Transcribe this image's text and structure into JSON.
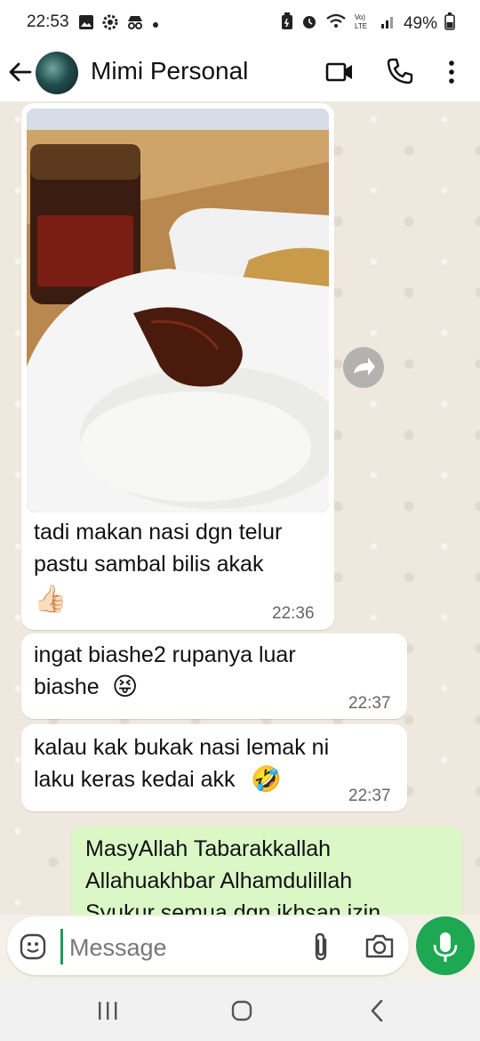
{
  "status_bar": {
    "time": "22:53",
    "battery": "49%",
    "left_icons": [
      "gallery-icon",
      "settings-gear-icon",
      "incognito-icon",
      "dot-icon"
    ],
    "right_icons": [
      "battery-saver-icon",
      "alarm-icon",
      "wifi-icon",
      "volte-icon",
      "signal-icon",
      "battery-icon"
    ]
  },
  "header": {
    "contact_name": "Mimi Personal"
  },
  "messages": [
    {
      "direction": "incoming",
      "has_photo": true,
      "text": "tadi makan nasi dgn telur pastu sambal bilis akak",
      "emoji": "👍🏻",
      "time": "22:36"
    },
    {
      "direction": "incoming",
      "text": "ingat biashe2 rupanya luar biashe",
      "emoji": "😝",
      "time": "22:37"
    },
    {
      "direction": "incoming",
      "text": "kalau kak bukak nasi lemak ni laku keras kedai akk",
      "emoji": "🤣",
      "time": "22:37"
    },
    {
      "direction": "outgoing",
      "text": "MasyAllah Tabarakkallah Allahuakhbar Alhamdulillah Syukur semua dgn ikhsan izin"
    }
  ],
  "composer": {
    "placeholder": "Message"
  },
  "colors": {
    "incoming_bubble": "#ffffff",
    "outgoing_bubble": "#dbf7c6",
    "accent_green": "#1da851",
    "chat_background": "#efe8de"
  }
}
